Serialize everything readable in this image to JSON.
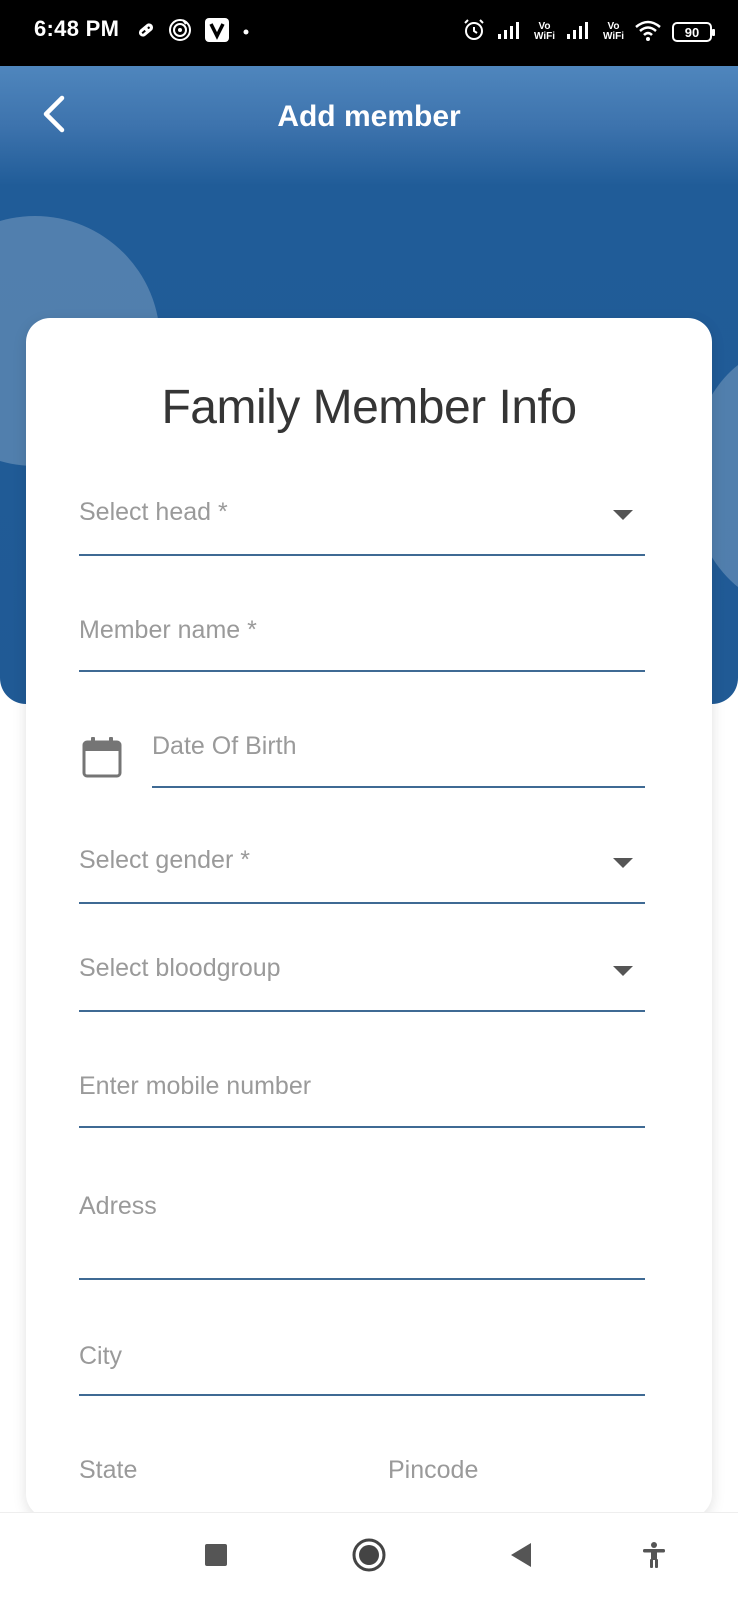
{
  "status_bar": {
    "time": "6:48 PM",
    "battery": "90",
    "vowifi_top": "Vo",
    "vowifi_bottom": "WiFi"
  },
  "header": {
    "title": "Add member",
    "back_icon": "chevron-left-icon",
    "color": "#205a95"
  },
  "form": {
    "title": "Family Member Info",
    "fields": {
      "select_head": "Select head *",
      "member_name": "Member name *",
      "date_of_birth": "Date Of Birth",
      "select_gender": "Select gender *",
      "select_bloodgroup": "Select bloodgroup",
      "mobile_number": "Enter mobile number",
      "address": "Adress",
      "city": "City",
      "state": "State",
      "pincode": "Pincode"
    }
  },
  "nav_bar": {
    "icons": [
      "recents-square-icon",
      "home-circle-icon",
      "back-triangle-icon",
      "accessibility-icon"
    ]
  }
}
